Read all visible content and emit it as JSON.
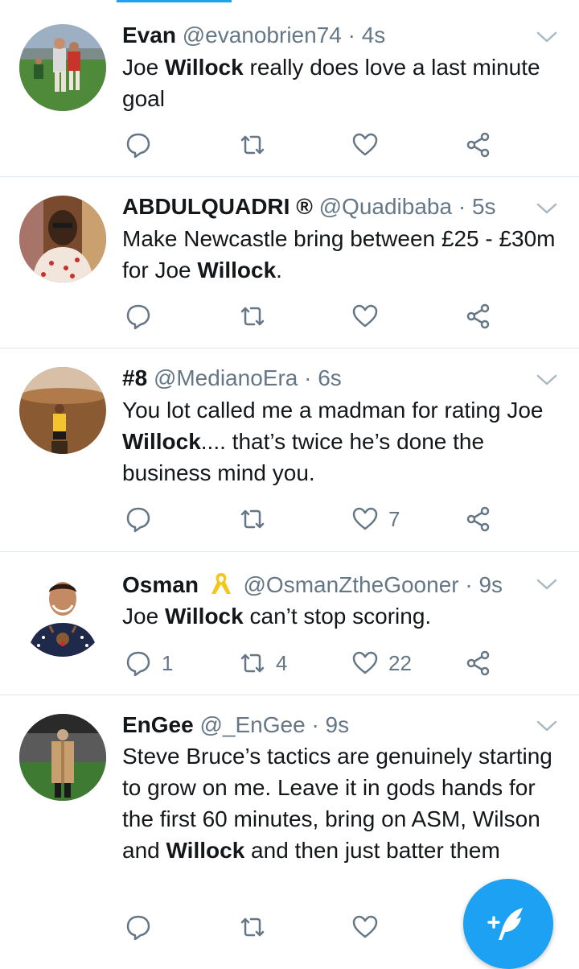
{
  "tweets": [
    {
      "name": "Evan",
      "handle": "@evanobrien74",
      "sep": "·",
      "time": "4s",
      "text_parts": [
        "Joe ",
        "Willock",
        " really does love a last minute goal"
      ],
      "counts": {
        "reply": "",
        "retweet": "",
        "like": ""
      },
      "avatar_icon": "hurling-players-avatar"
    },
    {
      "name": "ABDULQUADRI ®",
      "handle": "@Quadibaba",
      "sep": "·",
      "time": "5s",
      "text_parts": [
        "Make Newcastle bring between  £25 - £30m for Joe ",
        "Willock",
        "."
      ],
      "counts": {
        "reply": "",
        "retweet": "",
        "like": ""
      },
      "avatar_icon": "man-portrait-avatar"
    },
    {
      "name": "#8",
      "handle": "@MedianoEra",
      "sep": "·",
      "time": "6s",
      "text_parts": [
        "You lot called me a madman for rating Joe ",
        "Willock",
        ".... that’s twice he’s done the business mind you."
      ],
      "counts": {
        "reply": "",
        "retweet": "",
        "like": "7"
      },
      "avatar_icon": "lakers-jersey-avatar"
    },
    {
      "name": "Osman",
      "handle": "@OsmanZtheGooner",
      "sep": "·",
      "time": "9s",
      "text_parts": [
        "Joe ",
        "Willock",
        " can’t stop scoring."
      ],
      "counts": {
        "reply": "1",
        "retweet": "4",
        "like": "22"
      },
      "avatar_icon": "christmas-sweater-avatar",
      "badge_icon": "yellow-ribbon-icon"
    },
    {
      "name": "EnGee",
      "handle": "@_EnGee",
      "sep": "·",
      "time": "9s",
      "text_parts": [
        "Steve Bruce’s tactics are genuinely starting to grow on me. Leave it in gods hands for the first 60 minutes, bring on ASM, Wilson and ",
        "Willock",
        " and then just batter them"
      ],
      "counts": {
        "reply": "",
        "retweet": "",
        "like": ""
      },
      "avatar_icon": "stadium-coat-avatar"
    }
  ],
  "fab": {
    "icon": "compose-tweet-icon"
  },
  "colors": {
    "accent": "#1da1f2",
    "secondary_text": "#657786",
    "divider": "#e1e8ed",
    "ribbon": "#f5c518"
  }
}
